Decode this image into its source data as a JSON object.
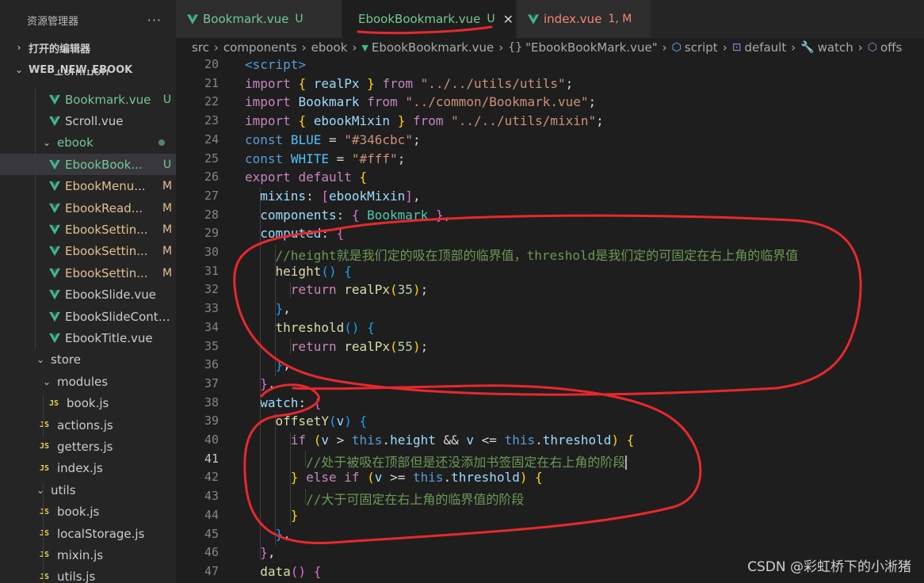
{
  "sidebar": {
    "title": "资源管理器",
    "more": "···",
    "open_editors": "打开的编辑器",
    "project": "WEB_NEW_EBOOK",
    "clipped_item": "common",
    "rows": [
      {
        "label": "Bookmark.vue",
        "badge": "U",
        "kind": "vue",
        "state": "untracked"
      },
      {
        "label": "Scroll.vue",
        "badge": "",
        "kind": "vue",
        "state": "clean"
      },
      {
        "label": "ebook",
        "badge": "",
        "kind": "folder",
        "state": "dot"
      },
      {
        "label": "EbookBook...",
        "badge": "U",
        "kind": "vue",
        "state": "untracked"
      },
      {
        "label": "EbookMenu...",
        "badge": "M",
        "kind": "vue",
        "state": "modified"
      },
      {
        "label": "EbookRead...",
        "badge": "M",
        "kind": "vue",
        "state": "modified"
      },
      {
        "label": "EbookSettin...",
        "badge": "M",
        "kind": "vue",
        "state": "modified"
      },
      {
        "label": "EbookSettin...",
        "badge": "M",
        "kind": "vue",
        "state": "modified"
      },
      {
        "label": "EbookSettin...",
        "badge": "M",
        "kind": "vue",
        "state": "modified"
      },
      {
        "label": "EbookSlide.vue",
        "badge": "",
        "kind": "vue",
        "state": "clean"
      },
      {
        "label": "EbookSlideConte...",
        "badge": "",
        "kind": "vue",
        "state": "clean"
      },
      {
        "label": "EbookTitle.vue",
        "badge": "",
        "kind": "vue",
        "state": "clean"
      },
      {
        "label": "store",
        "badge": "",
        "kind": "folder",
        "state": "clean"
      },
      {
        "label": "modules",
        "badge": "",
        "kind": "folder",
        "state": "clean"
      },
      {
        "label": "book.js",
        "badge": "",
        "kind": "js",
        "state": "clean"
      },
      {
        "label": "actions.js",
        "badge": "",
        "kind": "js",
        "state": "clean"
      },
      {
        "label": "getters.js",
        "badge": "",
        "kind": "js",
        "state": "clean"
      },
      {
        "label": "index.js",
        "badge": "",
        "kind": "js",
        "state": "clean"
      },
      {
        "label": "utils",
        "badge": "",
        "kind": "folder",
        "state": "clean"
      },
      {
        "label": "book.js",
        "badge": "",
        "kind": "js",
        "state": "clean"
      },
      {
        "label": "localStorage.js",
        "badge": "",
        "kind": "js",
        "state": "clean"
      },
      {
        "label": "mixin.js",
        "badge": "",
        "kind": "js",
        "state": "clean"
      },
      {
        "label": "utils.js",
        "badge": "",
        "kind": "js",
        "state": "clean"
      }
    ]
  },
  "tabs": [
    {
      "name": "Bookmark.vue",
      "status": "U",
      "color": "#73c991",
      "close": ""
    },
    {
      "name": "EbookBookmark.vue",
      "status": "U",
      "color": "#73c991",
      "close": "✕"
    },
    {
      "name": "index.vue",
      "status": "1, M",
      "color": "#f48771",
      "close": ""
    }
  ],
  "breadcrumb": [
    "src",
    "components",
    "ebook",
    "EbookBookmark.vue",
    "\"EbookBookMark.vue\"",
    "script",
    "default",
    "watch",
    "offs"
  ],
  "code": {
    "line_numbers": [
      "20",
      "21",
      "22",
      "23",
      "24",
      "25",
      "26",
      "27",
      "28",
      "29",
      "30",
      "31",
      "32",
      "33",
      "34",
      "35",
      "36",
      "37",
      "38",
      "39",
      "40",
      "41",
      "42",
      "43",
      "44",
      "45",
      "46",
      "47"
    ],
    "current_line": "41",
    "tokens": {
      "script_tag": "<script>",
      "import": "import",
      "from": "from",
      "const": "const",
      "export": "export",
      "default": "default",
      "return": "return",
      "if": "if",
      "else": "else",
      "this": "this",
      "realPx": "realPx",
      "Bookmark": "Bookmark",
      "ebookMixin": "ebookMixin",
      "path_utils": "\"../../utils/utils\"",
      "path_bookmark": "\"../common/Bookmark.vue\"",
      "path_mixin": "\"../../utils/mixin\"",
      "BLUE": "BLUE",
      "WHITE": "WHITE",
      "blue_val": "\"#346cbc\"",
      "white_val": "\"#fff\"",
      "mixins": "mixins",
      "components": "components",
      "computed": "computed",
      "comment_30": "//height就是我们定的吸在顶部的临界值，threshold是我们定的可固定在右上角的临界值",
      "height": "height",
      "threshold": "threshold",
      "n35": "35",
      "n55": "55",
      "watch": "watch",
      "offsetY": "offsetY",
      "v": "v",
      "comment_41": "//处于被吸在顶部但是还没添加书签固定在右上角的阶段",
      "comment_43": "//大于可固定在右上角的临界值的阶段",
      "data": "data"
    }
  },
  "watermark": "CSDN @彩虹桥下的小淅猪"
}
